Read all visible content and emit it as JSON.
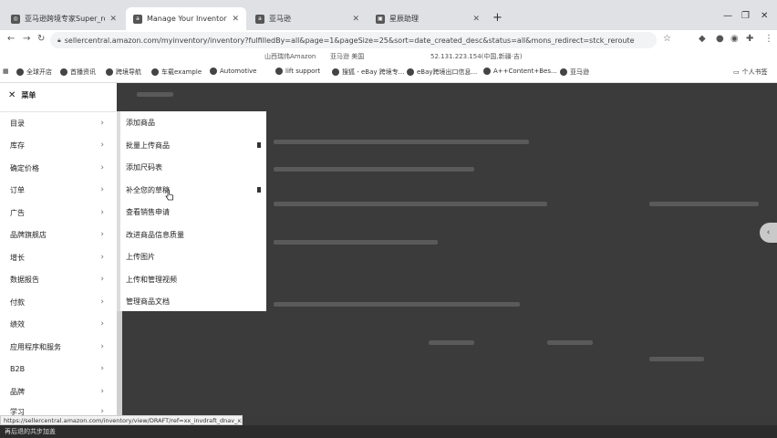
{
  "browser": {
    "tabs": [
      {
        "title": "亚马逊跨境专家Super_rowe",
        "active": false
      },
      {
        "title": "Manage Your Inventory",
        "active": true
      },
      {
        "title": "亚马逊",
        "active": false
      },
      {
        "title": "星辰助理",
        "active": false
      }
    ],
    "new_tab_glyph": "+",
    "url": "sellercentral.amazon.com/myinventory/inventory?fulfilledBy=all&page=1&pageSize=25&sort=date_created_desc&status=all&mons_redirect=stck_reroute",
    "info": {
      "left": "山西瑞伟Amazon",
      "mid": "亚马逊 美国",
      "right": "52.131.223.154(中国,新疆·吉)"
    },
    "bookmarks": [
      "全球开店",
      "首播资讯",
      "跨境导航",
      "车载example",
      "Automotive",
      "lift support",
      "搜狐 - eBay 跨境专...",
      "eBay跨境出口信息...",
      "A++Content+Bes...",
      "亚马逊"
    ],
    "bookmarks_right": "个人书签"
  },
  "menu": {
    "close_glyph": "✕",
    "title": "菜单",
    "items": [
      "目录",
      "库存",
      "确定价格",
      "订单",
      "广告",
      "品牌旗舰店",
      "增长",
      "数据报告",
      "付款",
      "绩效",
      "应用程序和服务",
      "B2B",
      "品牌",
      "学习"
    ],
    "chevron": "›"
  },
  "submenu": {
    "items": [
      "添加商品",
      "批量上传商品",
      "添加尺码表",
      "补全您的草稿",
      "查看销售申请",
      "改进商品信息质量",
      "上传图片",
      "上传和管理视频",
      "管理商品文档"
    ]
  },
  "status": {
    "link_url": "https://sellercentral.amazon.com/inventory/view/DRAFT/ref=xx_invdraft_dnav_xx",
    "bottom_text": "再后退的共步加盖"
  },
  "side_button_glyph": "‹",
  "colors": {
    "overlay": "#3b3b3b",
    "menu_bg": "#ffffff",
    "tabbar": "#dfe1e5"
  }
}
